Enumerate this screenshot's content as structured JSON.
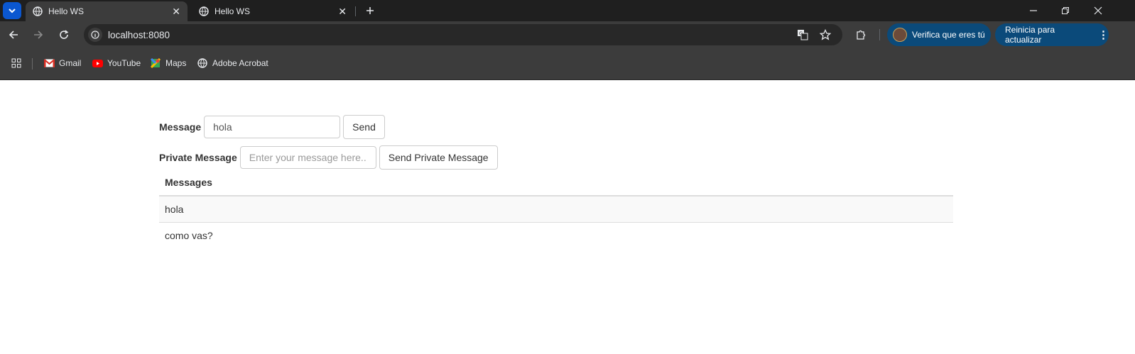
{
  "browser": {
    "tabs": [
      {
        "title": "Hello WS",
        "active": true
      },
      {
        "title": "Hello WS",
        "active": false
      }
    ],
    "url": "localhost:8080",
    "profile_pill": "Verifica que eres tú",
    "update_pill": "Reinicia para actualizar",
    "bookmarks": [
      {
        "label": "Gmail",
        "icon": "gmail-icon"
      },
      {
        "label": "YouTube",
        "icon": "youtube-icon"
      },
      {
        "label": "Maps",
        "icon": "maps-icon"
      },
      {
        "label": "Adobe Acrobat",
        "icon": "globe-icon"
      }
    ],
    "colors": {
      "accent": "#0b57d0",
      "pill": "#0b4a7a"
    }
  },
  "page": {
    "message_label": "Message",
    "message_value": "hola",
    "send_label": "Send",
    "private_label": "Private Message",
    "private_placeholder": "Enter your message here...",
    "send_private_label": "Send Private Message",
    "messages_header": "Messages",
    "messages": [
      "hola",
      "como vas?"
    ]
  }
}
